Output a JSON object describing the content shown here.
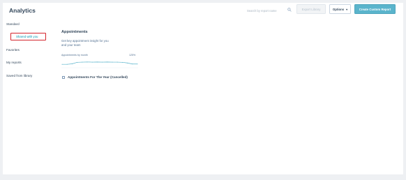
{
  "header": {
    "title": "Analytics",
    "search_placeholder": "Search by report name",
    "export_label": "Export Library",
    "options_label": "Options",
    "create_label": "Create Custom Report"
  },
  "sidebar": {
    "items": [
      {
        "label": "Standard"
      },
      {
        "label": "Shared with you"
      },
      {
        "label": "Favorites"
      },
      {
        "label": "My reports"
      },
      {
        "label": "Saved from library"
      }
    ],
    "active_index": 1
  },
  "card": {
    "title": "Appointments",
    "description": "Get key appointment insight for you and your team",
    "chart_label": "Appointments by month",
    "chart_value": "125%"
  },
  "chart_data": {
    "type": "line",
    "x": [
      0,
      1,
      2,
      3,
      4,
      5,
      6,
      7,
      8,
      9,
      10,
      11,
      12,
      13,
      14,
      15
    ],
    "series": [
      {
        "values": [
          2,
          2,
          2.3,
          3.2,
          3.3,
          3.4,
          3.3,
          3.4,
          3.3,
          3.4,
          3.3,
          3.3,
          3.2,
          2.8,
          2.2,
          2.2
        ]
      }
    ],
    "ylim": [
      0,
      5
    ]
  },
  "reports": [
    {
      "title": "Appointments For The Year (Cancelled)"
    }
  ],
  "colors": {
    "accent": "#5ab4cc",
    "highlight": "#d4232b",
    "link": "#0091ae"
  }
}
